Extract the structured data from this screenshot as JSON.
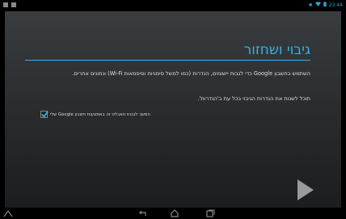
{
  "status_bar": {
    "time": "23:44"
  },
  "setup": {
    "title": "גיבוי ושחזור",
    "description": "השתמש בחשבון Google כדי לגבות יישומים, הגדרות (כמו למשל סימניות וסיסמאות Wi-Fi) ונתונים אחרים.",
    "change_note": "תוכל לשנות את הגדרות הגיבוי בכל עת ב'הגדרות'.",
    "backup_checkbox_label": "המשך לגבות טאבלט זה באמצעות חשבון Google שלי",
    "backup_checked": true
  },
  "colors": {
    "accent": "#31b4e6"
  }
}
